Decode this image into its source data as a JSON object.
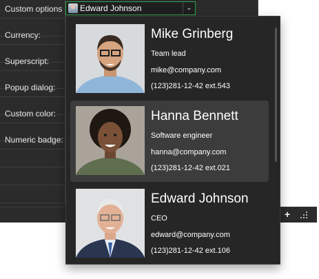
{
  "grid": {
    "rows": [
      {
        "label": "Custom options ..."
      },
      {
        "label": ""
      },
      {
        "label": "Currency:"
      },
      {
        "label": ""
      },
      {
        "label": "Superscript:"
      },
      {
        "label": ""
      },
      {
        "label": "Popup dialog:"
      },
      {
        "label": ""
      },
      {
        "label": "Custom color:"
      },
      {
        "label": ""
      },
      {
        "label": "Numeric badge:"
      },
      {
        "label": ""
      }
    ],
    "editor_value": "Edward Johnson"
  },
  "popup": {
    "contacts": [
      {
        "name": "Mike Grinberg",
        "role": "Team lead",
        "email": "mike@company.com",
        "phone": "(123)281-12-42 ext.543"
      },
      {
        "name": "Hanna Bennett",
        "role": "Software engineer",
        "email": "hanna@company.com",
        "phone": "(123)281-12-42 ext.021"
      },
      {
        "name": "Edward Johnson",
        "role": "CEO",
        "email": "edward@company.com",
        "phone": "(123)281-12-42 ext.106"
      }
    ],
    "selected_index": 1
  },
  "bottom_bar": {
    "add_icon": "plus-icon",
    "resize_icon": "resize-grip-icon"
  }
}
